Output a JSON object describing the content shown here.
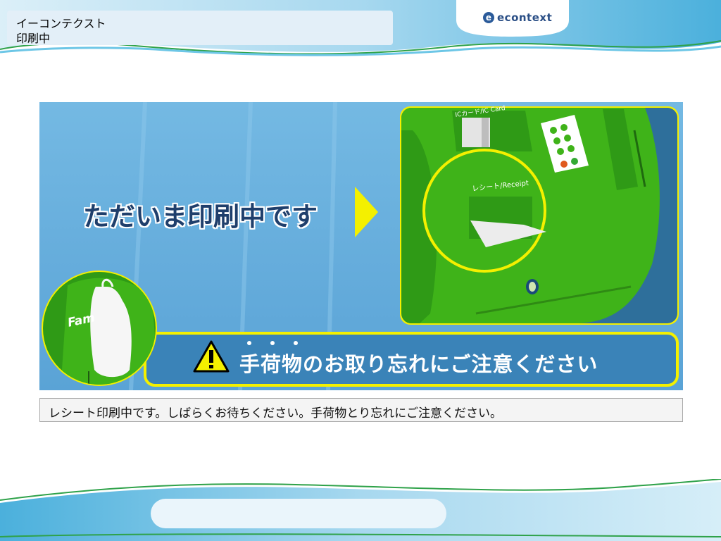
{
  "header": {
    "title_line1": "イーコンテクスト",
    "title_line2": "印刷中",
    "logo_mark": "e",
    "logo_text": "econtext"
  },
  "banner": {
    "headline": "ただいま印刷中です",
    "receipt_slot_label": "レシート/Receipt",
    "ic_card_label": "ICカード/IC Card",
    "bag_text": "Fam",
    "warning_text": "手荷物のお取り忘れにご注意ください",
    "warning_icon": "warning-icon"
  },
  "status": {
    "message": "レシート印刷中です。しばらくお待ちください。手荷物とり忘れにご注意ください。"
  },
  "colors": {
    "accent_blue": "#6aaedc",
    "band_blue": "#3a83b8",
    "machine_green": "#3fb319",
    "highlight_yellow": "#f4f000",
    "header_wave": "#8ccbe8"
  }
}
